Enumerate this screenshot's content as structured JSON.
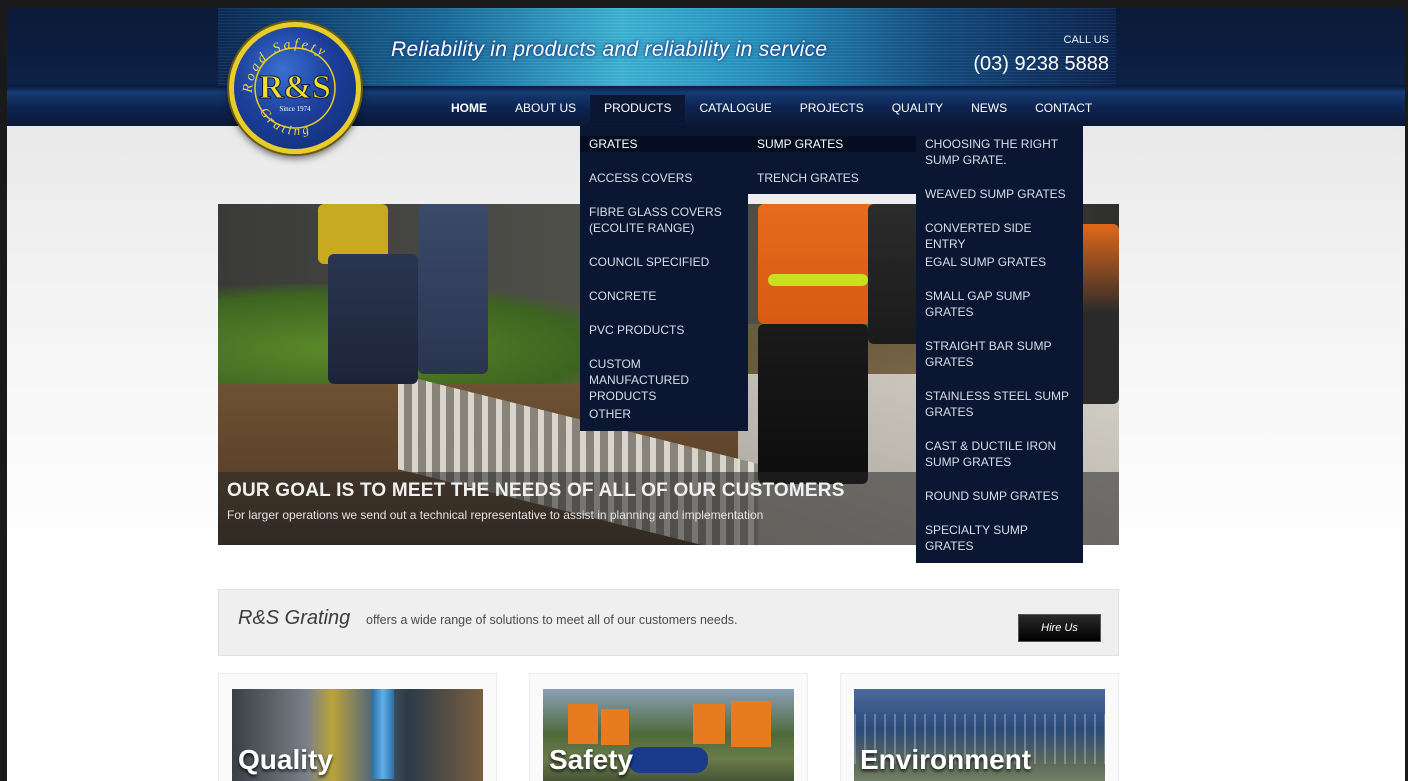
{
  "header": {
    "tagline": "Reliability in products and reliability in service",
    "call_label": "CALL US",
    "phone": "(03) 9238 5888",
    "logo": {
      "ring_top": "Road Safety",
      "ring_bottom": "Grating",
      "brand": "R&S",
      "since": "Since 1974"
    }
  },
  "nav": {
    "items": [
      {
        "label": "HOME"
      },
      {
        "label": "ABOUT US"
      },
      {
        "label": "PRODUCTS"
      },
      {
        "label": "CATALOGUE"
      },
      {
        "label": "PROJECTS"
      },
      {
        "label": "QUALITY"
      },
      {
        "label": "NEWS"
      },
      {
        "label": "CONTACT"
      }
    ]
  },
  "menu": {
    "products": [
      "GRATES",
      "ACCESS COVERS",
      "FIBRE GLASS COVERS (ECOLITE RANGE)",
      "COUNCIL SPECIFIED",
      "CONCRETE",
      "PVC PRODUCTS",
      "CUSTOM MANUFACTURED PRODUCTS",
      "OTHER"
    ],
    "grates": [
      "SUMP GRATES",
      "TRENCH GRATES"
    ],
    "sump_grates": [
      "CHOOSING THE RIGHT SUMP GRATE.",
      "WEAVED SUMP GRATES",
      "CONVERTED SIDE ENTRY",
      "EGAL SUMP GRATES",
      "SMALL GAP SUMP GRATES",
      "STRAIGHT BAR SUMP GRATES",
      "STAINLESS STEEL SUMP GRATES",
      "CAST & DUCTILE IRON SUMP GRATES",
      "ROUND SUMP GRATES",
      "SPECIALTY SUMP GRATES"
    ]
  },
  "hero": {
    "title": "OUR GOAL IS TO MEET THE NEEDS OF ALL OF OUR CUSTOMERS",
    "subtitle": "For larger operations we send out a technical representative to assist in planning and implementation"
  },
  "intro": {
    "brand": "R&S Grating",
    "text": "offers a wide range of solutions to meet all of our customers needs.",
    "button": "Hire Us"
  },
  "features": [
    {
      "label": "Quality"
    },
    {
      "label": "Safety"
    },
    {
      "label": "Environment"
    }
  ],
  "colors": {
    "header_dark": "#0c2147",
    "menu_bg": "#0b1633",
    "logo_yellow": "#e8cc2a",
    "logo_blue": "#1c3f9a"
  }
}
